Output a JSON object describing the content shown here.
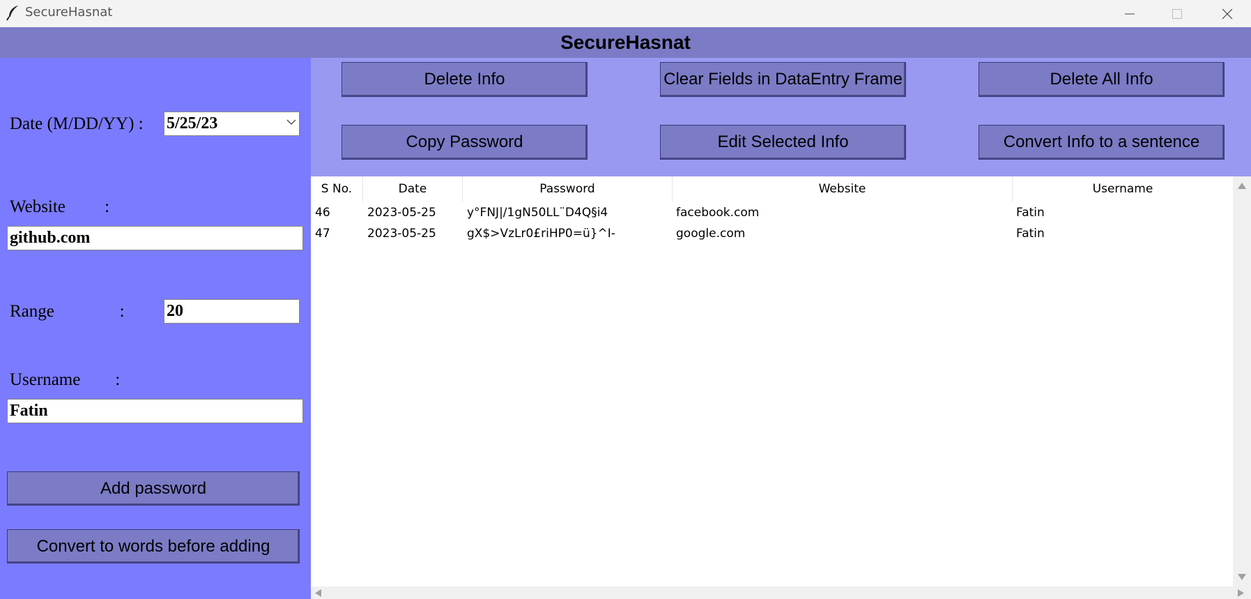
{
  "window": {
    "title": "SecureHasnat",
    "icon": "feather-icon"
  },
  "header": {
    "title": "SecureHasnat"
  },
  "form": {
    "date_label": "Date (M/DD/YY) :",
    "date_value": "5/25/23",
    "website_label": "Website         :",
    "website_value": "github.com",
    "range_label": "Range               :",
    "range_value": "20",
    "username_label": "Username        :",
    "username_value": "Fatin",
    "add_password_label": "Add password",
    "convert_words_label": "Convert to words before adding"
  },
  "toolbar": {
    "delete_info": "Delete Info",
    "clear_fields": "Clear Fields in DataEntry Frame",
    "delete_all": "Delete All Info",
    "copy_password": "Copy Password",
    "edit_selected": "Edit Selected Info",
    "convert_sentence": "Convert Info to a sentence"
  },
  "table": {
    "columns": [
      "S No.",
      "Date",
      "Password",
      "Website",
      "Username"
    ],
    "rows": [
      [
        "46",
        "2023-05-25",
        "y°FNJ|/1gN50LL¨D4Q§i4",
        "facebook.com",
        "Fatin"
      ],
      [
        "47",
        "2023-05-25",
        "gX$>VzLr0£riHP0=ü}^I-",
        "google.com",
        "Fatin"
      ]
    ]
  },
  "colors": {
    "left_panel": "#7b7bff",
    "header": "#7b7bc6",
    "button": "#7b7bc6",
    "toolbar_bg": "#9999f2"
  }
}
